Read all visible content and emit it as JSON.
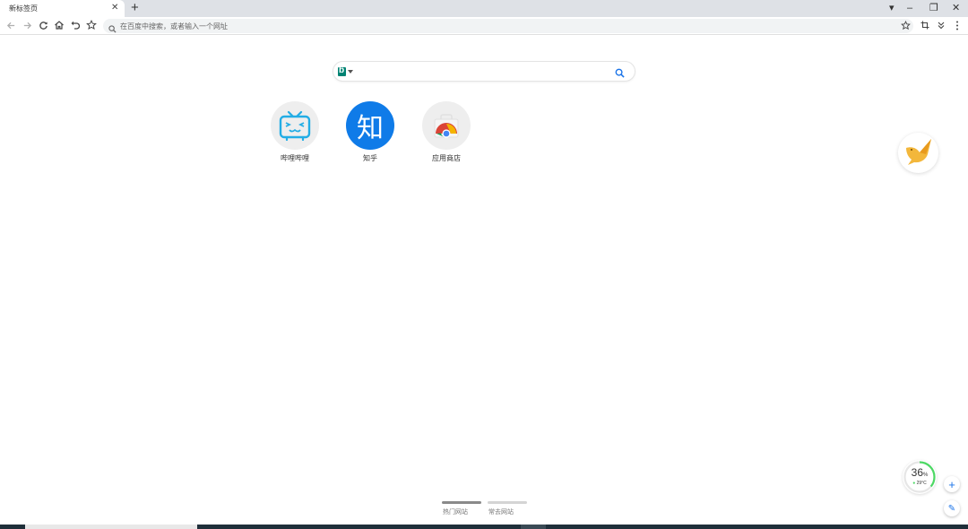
{
  "browser": {
    "tab": {
      "title": "新标签页",
      "close_glyph": "✕"
    },
    "new_tab_glyph": "+",
    "window_controls": {
      "dropdown_glyph": "▾",
      "minimize_glyph": "–",
      "restore_glyph": "❐",
      "close_glyph": "✕"
    },
    "toolbar": {
      "icons": [
        "back-icon",
        "forward-icon",
        "reload-icon",
        "home-icon",
        "undo-icon",
        "bookmark-star-icon"
      ],
      "right_icons": [
        "star-icon",
        "crop-icon",
        "chevron-double-down-icon",
        "more-vert-icon"
      ]
    },
    "omnibox": {
      "placeholder": "在百度中搜索，或者输入一个网址",
      "value": ""
    }
  },
  "newtab": {
    "search": {
      "engine": "bing",
      "value": "",
      "icon": "search-icon"
    },
    "shortcuts": [
      {
        "label": "哔哩哔哩",
        "icon": "bilibili-tv-icon"
      },
      {
        "label": "知乎",
        "icon": "zhihu-icon",
        "glyph": "知"
      },
      {
        "label": "应用商店",
        "icon": "chrome-store-icon"
      }
    ],
    "pages": [
      {
        "label": "热门网站",
        "active": true
      },
      {
        "label": "常去网站",
        "active": false
      }
    ],
    "weather": {
      "value": "36",
      "unit": "%",
      "temp": "29°C"
    },
    "fab_add_glyph": "+",
    "fab_edit_glyph": "✎"
  },
  "colors": {
    "accent": "#1a73e8",
    "zhihu": "#0f7be8",
    "bilibili": "#23ade5",
    "bing": "#008373",
    "weather_ring": "#4cd964"
  }
}
